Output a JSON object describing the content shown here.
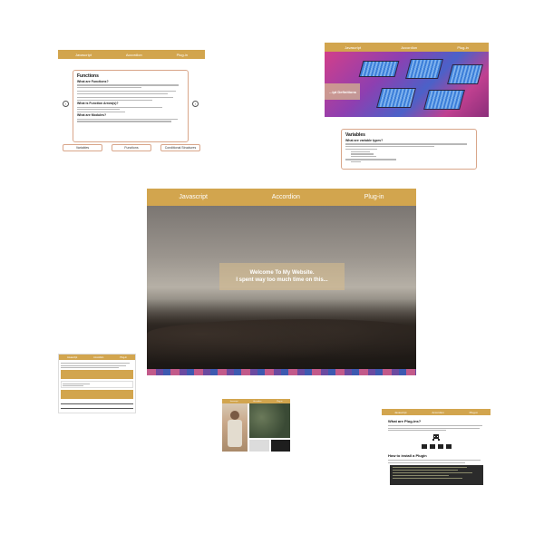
{
  "nav": {
    "items": [
      "Javascript",
      "Accordion",
      "Plug-in"
    ]
  },
  "hero": {
    "line1": "Welcome To My Website.",
    "line2": "I spent way too much time on this..."
  },
  "functions_page": {
    "title": "Functions",
    "subtitle": "What are Functions?",
    "subtitle2": "What is Function Arrow(s)?",
    "subtitle3": "What are Modules?",
    "prev_icon": "chevron-left",
    "next_icon": "chevron-right",
    "buttons": [
      "Variables",
      "Functions",
      "Conditional Structures"
    ]
  },
  "variables_page": {
    "banner": "...ipt Definitions",
    "title": "Variables",
    "subtitle": "What are variable types?"
  },
  "plugins_page": {
    "title": "What are Plug-ins?",
    "subtitle": "How to install a Plugin"
  },
  "colors": {
    "accent": "#d2a54e",
    "card_border": "#d9a68a"
  }
}
